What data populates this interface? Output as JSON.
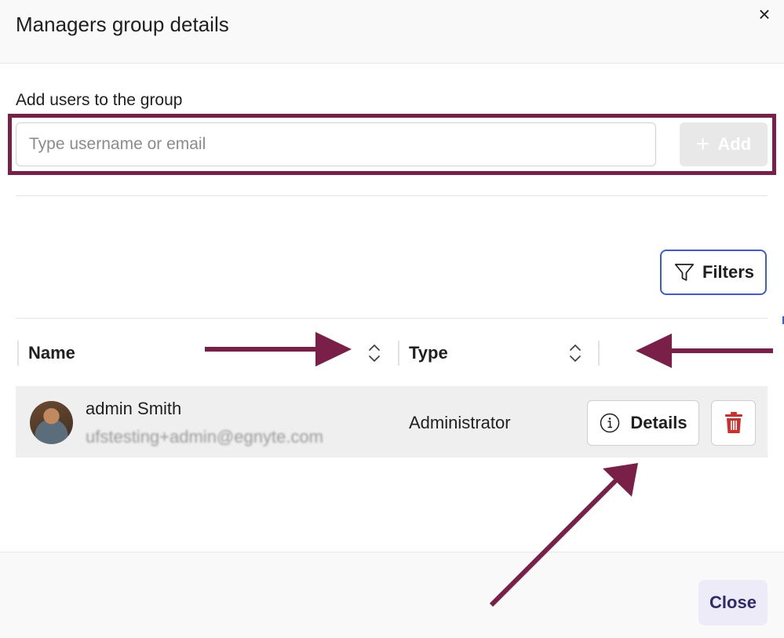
{
  "dialog": {
    "title": "Managers group details",
    "close_icon": "×"
  },
  "add_users": {
    "label": "Add users to the group",
    "placeholder": "Type username or email",
    "value": "",
    "add_label": "Add"
  },
  "filters": {
    "label": "Filters"
  },
  "table": {
    "columns": [
      {
        "label": "Name",
        "sortable": true
      },
      {
        "label": "Type",
        "sortable": true
      }
    ],
    "rows": [
      {
        "name": "admin Smith",
        "email": "ufstesting+admin@egnyte.com",
        "type": "Administrator",
        "details_label": "Details"
      }
    ]
  },
  "footer": {
    "close_label": "Close"
  },
  "colors": {
    "annotation": "#7a2048",
    "filters_border": "#3b5bdb",
    "delete_icon": "#d62b2b",
    "close_text": "#2f2a6b"
  },
  "icons": {
    "close": "close-icon",
    "add": "plus-icon",
    "filters": "funnel-icon",
    "sort": "sort-icon",
    "details": "info-icon",
    "delete": "trash-icon"
  }
}
